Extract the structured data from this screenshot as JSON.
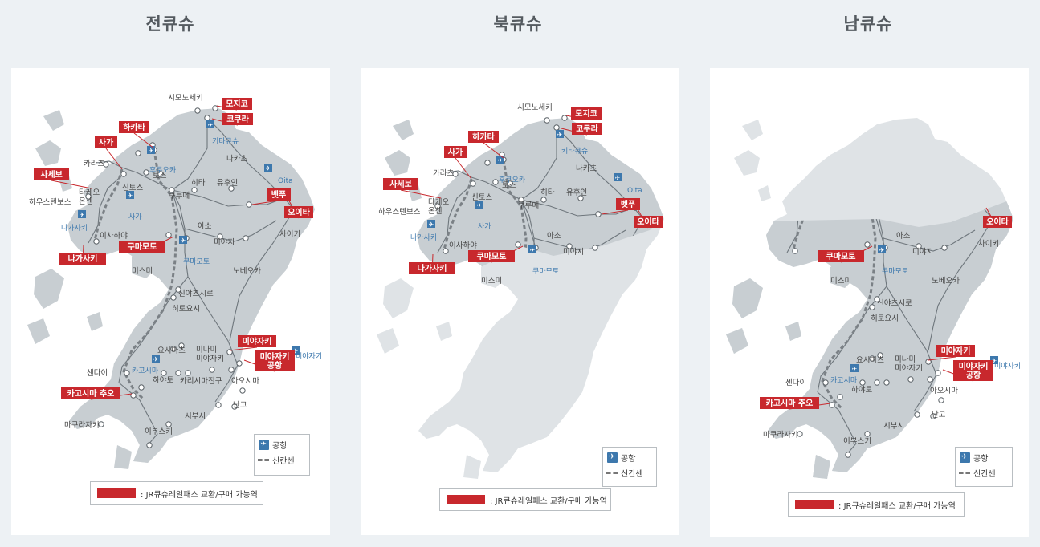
{
  "columns": [
    {
      "title": "전큐슈",
      "legend": {
        "airport": "공항",
        "shinkansen": "신칸센"
      },
      "key": "JR큐슈레일패스 교환/구매 가능역",
      "red_labels": [
        "모지코",
        "코쿠라",
        "하카타",
        "사가",
        "사세보",
        "벳푸",
        "오이타",
        "나가사키",
        "쿠마모토",
        "미야자키",
        "미야자키\n공항",
        "카고시마 추오"
      ],
      "stations": [
        "시모노세키",
        "카라츠",
        "하우스텐보스",
        "타케오\n온센",
        "신토스",
        "토스",
        "쿠루메",
        "히타",
        "유후인",
        "나카츠",
        "아소",
        "미야지",
        "이사하야",
        "미스미",
        "신야츠시로",
        "히토요시",
        "요시마츠",
        "센다이",
        "하야토",
        "카리시마진구",
        "미나미\n미야자키",
        "아오시마",
        "난고",
        "시부시",
        "마쿠라자키",
        "이부스키",
        "노베오카",
        "사이키"
      ],
      "airports": [
        "키타큐슈",
        "후쿠오카",
        "Oita",
        "사가",
        "나가사키",
        "쿠마모토",
        "카고시마",
        "미야자키"
      ]
    },
    {
      "title": "북큐슈",
      "legend": {
        "airport": "공항",
        "shinkansen": "신칸센"
      },
      "key": "JR큐슈레일패스 교환/구매 가능역",
      "red_labels": [
        "모지코",
        "코쿠라",
        "하카타",
        "사가",
        "사세보",
        "벳푸",
        "오이타",
        "나가사키",
        "쿠마모토"
      ],
      "stations": [
        "시모노세키",
        "카라츠",
        "하우스텐보스",
        "타케오\n온센",
        "신토스",
        "토스",
        "쿠루메",
        "히타",
        "유후인",
        "나카츠",
        "아소",
        "미야지",
        "이사하야",
        "미스미"
      ],
      "airports": [
        "키타큐슈",
        "후쿠오카",
        "Oita",
        "사가",
        "나가사키",
        "쿠마모토"
      ]
    },
    {
      "title": "남큐슈",
      "legend": {
        "airport": "공항",
        "shinkansen": "신칸센"
      },
      "key": "JR큐슈레일패스 교환/구매 가능역",
      "red_labels": [
        "오이타",
        "쿠마모토",
        "미야자키",
        "미야자키\n공항",
        "카고시마 추오"
      ],
      "stations": [
        "아소",
        "미야지",
        "미스미",
        "신야츠시로",
        "히토요시",
        "요시마츠",
        "센다이",
        "하야토",
        "미나미\n미야자키",
        "아오시마",
        "난고",
        "시부시",
        "마쿠라자키",
        "이부스키",
        "노베오카",
        "사이키"
      ],
      "airports": [
        "쿠마모토",
        "카고시마",
        "미야자키"
      ]
    }
  ]
}
